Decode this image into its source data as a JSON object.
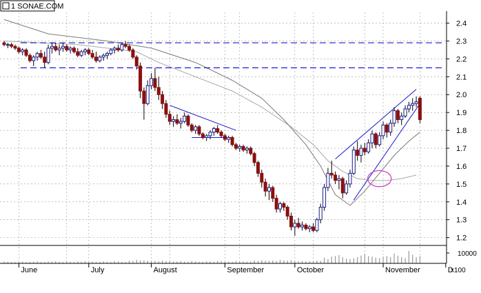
{
  "window": {
    "title": "1 SONAE.COM"
  },
  "colors": {
    "up": "#1a1a8c",
    "down": "#8b1010",
    "channel": "#1a1acc",
    "ellipse": "#cc33cc",
    "grid": "#9a9a9a",
    "ma": "#9a9a9a",
    "volume": "#999999"
  },
  "chart_data": {
    "type": "candlestick",
    "title": "1 SONAE.COM",
    "price_axis": {
      "range": [
        1.16,
        2.46
      ],
      "ticks": [
        "1.2",
        "1.3",
        "1.4",
        "1.5",
        "1.6",
        "1.7",
        "1.8",
        "1.9",
        "2.0",
        "2.1",
        "2.2",
        "2.3",
        "2.4"
      ],
      "side": "right"
    },
    "volume_axis": {
      "range": [
        0,
        16000
      ],
      "ticks": [
        "10000"
      ],
      "unit": "x100"
    },
    "months": [
      "June",
      "July",
      "August",
      "September",
      "October",
      "November",
      "D"
    ],
    "candles": [
      {
        "o": 2.29,
        "h": 2.3,
        "l": 2.27,
        "c": 2.28
      },
      {
        "o": 2.28,
        "h": 2.29,
        "l": 2.26,
        "c": 2.28
      },
      {
        "o": 2.28,
        "h": 2.29,
        "l": 2.26,
        "c": 2.27
      },
      {
        "o": 2.27,
        "h": 2.28,
        "l": 2.25,
        "c": 2.26
      },
      {
        "o": 2.26,
        "h": 2.27,
        "l": 2.23,
        "c": 2.24
      },
      {
        "o": 2.24,
        "h": 2.26,
        "l": 2.22,
        "c": 2.25
      },
      {
        "o": 2.25,
        "h": 2.26,
        "l": 2.21,
        "c": 2.22
      },
      {
        "o": 2.22,
        "h": 2.23,
        "l": 2.18,
        "c": 2.19
      },
      {
        "o": 2.19,
        "h": 2.22,
        "l": 2.16,
        "c": 2.21
      },
      {
        "o": 2.21,
        "h": 2.24,
        "l": 2.19,
        "c": 2.23
      },
      {
        "o": 2.23,
        "h": 2.25,
        "l": 2.2,
        "c": 2.21
      },
      {
        "o": 2.21,
        "h": 2.24,
        "l": 2.15,
        "c": 2.18
      },
      {
        "o": 2.18,
        "h": 2.28,
        "l": 2.17,
        "c": 2.26
      },
      {
        "o": 2.26,
        "h": 2.29,
        "l": 2.23,
        "c": 2.27
      },
      {
        "o": 2.27,
        "h": 2.29,
        "l": 2.24,
        "c": 2.25
      },
      {
        "o": 2.25,
        "h": 2.28,
        "l": 2.22,
        "c": 2.26
      },
      {
        "o": 2.26,
        "h": 2.29,
        "l": 2.24,
        "c": 2.27
      },
      {
        "o": 2.27,
        "h": 2.28,
        "l": 2.24,
        "c": 2.25
      },
      {
        "o": 2.25,
        "h": 2.27,
        "l": 2.23,
        "c": 2.26
      },
      {
        "o": 2.26,
        "h": 2.27,
        "l": 2.23,
        "c": 2.24
      },
      {
        "o": 2.24,
        "h": 2.26,
        "l": 2.21,
        "c": 2.22
      },
      {
        "o": 2.22,
        "h": 2.25,
        "l": 2.21,
        "c": 2.24
      },
      {
        "o": 2.24,
        "h": 2.26,
        "l": 2.22,
        "c": 2.25
      },
      {
        "o": 2.25,
        "h": 2.26,
        "l": 2.22,
        "c": 2.23
      },
      {
        "o": 2.23,
        "h": 2.25,
        "l": 2.2,
        "c": 2.21
      },
      {
        "o": 2.21,
        "h": 2.24,
        "l": 2.18,
        "c": 2.19
      },
      {
        "o": 2.19,
        "h": 2.22,
        "l": 2.18,
        "c": 2.21
      },
      {
        "o": 2.21,
        "h": 2.23,
        "l": 2.19,
        "c": 2.22
      },
      {
        "o": 2.22,
        "h": 2.24,
        "l": 2.2,
        "c": 2.23
      },
      {
        "o": 2.23,
        "h": 2.26,
        "l": 2.22,
        "c": 2.25
      },
      {
        "o": 2.25,
        "h": 2.27,
        "l": 2.23,
        "c": 2.26
      },
      {
        "o": 2.26,
        "h": 2.28,
        "l": 2.24,
        "c": 2.25
      },
      {
        "o": 2.25,
        "h": 2.29,
        "l": 2.24,
        "c": 2.28
      },
      {
        "o": 2.28,
        "h": 2.3,
        "l": 2.26,
        "c": 2.27
      },
      {
        "o": 2.27,
        "h": 2.28,
        "l": 2.24,
        "c": 2.25
      },
      {
        "o": 2.25,
        "h": 2.26,
        "l": 2.2,
        "c": 2.21
      },
      {
        "o": 2.21,
        "h": 2.22,
        "l": 2.14,
        "c": 2.16
      },
      {
        "o": 2.16,
        "h": 2.18,
        "l": 1.98,
        "c": 2.02
      },
      {
        "o": 2.02,
        "h": 2.04,
        "l": 1.86,
        "c": 1.95
      },
      {
        "o": 1.95,
        "h": 2.08,
        "l": 1.94,
        "c": 2.05
      },
      {
        "o": 2.05,
        "h": 2.12,
        "l": 2.03,
        "c": 2.09
      },
      {
        "o": 2.09,
        "h": 2.15,
        "l": 2.02,
        "c": 2.04
      },
      {
        "o": 2.04,
        "h": 2.1,
        "l": 1.97,
        "c": 2.0
      },
      {
        "o": 2.0,
        "h": 2.02,
        "l": 1.92,
        "c": 1.95
      },
      {
        "o": 1.95,
        "h": 1.97,
        "l": 1.87,
        "c": 1.89
      },
      {
        "o": 1.89,
        "h": 1.91,
        "l": 1.83,
        "c": 1.85
      },
      {
        "o": 1.85,
        "h": 1.88,
        "l": 1.82,
        "c": 1.86
      },
      {
        "o": 1.86,
        "h": 1.89,
        "l": 1.83,
        "c": 1.84
      },
      {
        "o": 1.84,
        "h": 1.87,
        "l": 1.81,
        "c": 1.85
      },
      {
        "o": 1.85,
        "h": 1.9,
        "l": 1.84,
        "c": 1.88
      },
      {
        "o": 1.88,
        "h": 1.89,
        "l": 1.82,
        "c": 1.83
      },
      {
        "o": 1.83,
        "h": 1.84,
        "l": 1.79,
        "c": 1.8
      },
      {
        "o": 1.8,
        "h": 1.83,
        "l": 1.78,
        "c": 1.82
      },
      {
        "o": 1.82,
        "h": 1.83,
        "l": 1.77,
        "c": 1.78
      },
      {
        "o": 1.78,
        "h": 1.79,
        "l": 1.75,
        "c": 1.76
      },
      {
        "o": 1.76,
        "h": 1.78,
        "l": 1.74,
        "c": 1.77
      },
      {
        "o": 1.77,
        "h": 1.8,
        "l": 1.75,
        "c": 1.79
      },
      {
        "o": 1.79,
        "h": 1.82,
        "l": 1.77,
        "c": 1.81
      },
      {
        "o": 1.81,
        "h": 1.83,
        "l": 1.78,
        "c": 1.79
      },
      {
        "o": 1.79,
        "h": 1.8,
        "l": 1.76,
        "c": 1.77
      },
      {
        "o": 1.77,
        "h": 1.78,
        "l": 1.74,
        "c": 1.75
      },
      {
        "o": 1.75,
        "h": 1.77,
        "l": 1.73,
        "c": 1.76
      },
      {
        "o": 1.76,
        "h": 1.77,
        "l": 1.71,
        "c": 1.72
      },
      {
        "o": 1.72,
        "h": 1.73,
        "l": 1.69,
        "c": 1.7
      },
      {
        "o": 1.7,
        "h": 1.72,
        "l": 1.68,
        "c": 1.71
      },
      {
        "o": 1.71,
        "h": 1.72,
        "l": 1.68,
        "c": 1.69
      },
      {
        "o": 1.69,
        "h": 1.71,
        "l": 1.67,
        "c": 1.7
      },
      {
        "o": 1.7,
        "h": 1.71,
        "l": 1.66,
        "c": 1.67
      },
      {
        "o": 1.67,
        "h": 1.68,
        "l": 1.6,
        "c": 1.62
      },
      {
        "o": 1.62,
        "h": 1.63,
        "l": 1.54,
        "c": 1.56
      },
      {
        "o": 1.56,
        "h": 1.58,
        "l": 1.48,
        "c": 1.51
      },
      {
        "o": 1.51,
        "h": 1.53,
        "l": 1.43,
        "c": 1.46
      },
      {
        "o": 1.46,
        "h": 1.5,
        "l": 1.41,
        "c": 1.48
      },
      {
        "o": 1.48,
        "h": 1.49,
        "l": 1.4,
        "c": 1.42
      },
      {
        "o": 1.42,
        "h": 1.44,
        "l": 1.34,
        "c": 1.36
      },
      {
        "o": 1.36,
        "h": 1.4,
        "l": 1.34,
        "c": 1.39
      },
      {
        "o": 1.39,
        "h": 1.4,
        "l": 1.35,
        "c": 1.37
      },
      {
        "o": 1.37,
        "h": 1.38,
        "l": 1.3,
        "c": 1.32
      },
      {
        "o": 1.32,
        "h": 1.34,
        "l": 1.24,
        "c": 1.26
      },
      {
        "o": 1.26,
        "h": 1.3,
        "l": 1.21,
        "c": 1.28
      },
      {
        "o": 1.28,
        "h": 1.31,
        "l": 1.25,
        "c": 1.26
      },
      {
        "o": 1.26,
        "h": 1.29,
        "l": 1.24,
        "c": 1.27
      },
      {
        "o": 1.27,
        "h": 1.28,
        "l": 1.24,
        "c": 1.25
      },
      {
        "o": 1.25,
        "h": 1.27,
        "l": 1.23,
        "c": 1.26
      },
      {
        "o": 1.26,
        "h": 1.28,
        "l": 1.23,
        "c": 1.24
      },
      {
        "o": 1.24,
        "h": 1.31,
        "l": 1.23,
        "c": 1.3
      },
      {
        "o": 1.3,
        "h": 1.39,
        "l": 1.28,
        "c": 1.37
      },
      {
        "o": 1.37,
        "h": 1.5,
        "l": 1.35,
        "c": 1.48
      },
      {
        "o": 1.48,
        "h": 1.59,
        "l": 1.46,
        "c": 1.56
      },
      {
        "o": 1.56,
        "h": 1.63,
        "l": 1.53,
        "c": 1.55
      },
      {
        "o": 1.55,
        "h": 1.57,
        "l": 1.5,
        "c": 1.52
      },
      {
        "o": 1.52,
        "h": 1.55,
        "l": 1.47,
        "c": 1.53
      },
      {
        "o": 1.53,
        "h": 1.54,
        "l": 1.42,
        "c": 1.45
      },
      {
        "o": 1.45,
        "h": 1.52,
        "l": 1.44,
        "c": 1.5
      },
      {
        "o": 1.5,
        "h": 1.58,
        "l": 1.48,
        "c": 1.56
      },
      {
        "o": 1.56,
        "h": 1.71,
        "l": 1.55,
        "c": 1.69
      },
      {
        "o": 1.69,
        "h": 1.74,
        "l": 1.63,
        "c": 1.66
      },
      {
        "o": 1.66,
        "h": 1.72,
        "l": 1.62,
        "c": 1.7
      },
      {
        "o": 1.7,
        "h": 1.73,
        "l": 1.66,
        "c": 1.68
      },
      {
        "o": 1.68,
        "h": 1.75,
        "l": 1.67,
        "c": 1.73
      },
      {
        "o": 1.73,
        "h": 1.8,
        "l": 1.7,
        "c": 1.78
      },
      {
        "o": 1.78,
        "h": 1.79,
        "l": 1.7,
        "c": 1.72
      },
      {
        "o": 1.72,
        "h": 1.79,
        "l": 1.71,
        "c": 1.77
      },
      {
        "o": 1.77,
        "h": 1.85,
        "l": 1.75,
        "c": 1.83
      },
      {
        "o": 1.83,
        "h": 1.84,
        "l": 1.76,
        "c": 1.79
      },
      {
        "o": 1.79,
        "h": 1.86,
        "l": 1.77,
        "c": 1.84
      },
      {
        "o": 1.84,
        "h": 1.93,
        "l": 1.82,
        "c": 1.91
      },
      {
        "o": 1.91,
        "h": 1.92,
        "l": 1.84,
        "c": 1.86
      },
      {
        "o": 1.86,
        "h": 1.9,
        "l": 1.83,
        "c": 1.88
      },
      {
        "o": 1.88,
        "h": 1.94,
        "l": 1.87,
        "c": 1.92
      },
      {
        "o": 1.92,
        "h": 1.96,
        "l": 1.9,
        "c": 1.94
      },
      {
        "o": 1.94,
        "h": 1.98,
        "l": 1.91,
        "c": 1.95
      },
      {
        "o": 1.95,
        "h": 1.99,
        "l": 1.93,
        "c": 1.96
      },
      {
        "o": 1.98,
        "h": 1.99,
        "l": 1.84,
        "c": 1.86
      }
    ],
    "moving_averages": [
      {
        "name": "",
        "points": [
          [
            0,
            2.3
          ],
          [
            20,
            2.28
          ],
          [
            36,
            2.24
          ],
          [
            42,
            2.18
          ],
          [
            52,
            2.1
          ],
          [
            62,
            2.02
          ],
          [
            70,
            1.93
          ],
          [
            78,
            1.82
          ],
          [
            84,
            1.72
          ],
          [
            88,
            1.63
          ],
          [
            92,
            1.57
          ],
          [
            96,
            1.53
          ],
          [
            100,
            1.52
          ],
          [
            104,
            1.52
          ],
          [
            108,
            1.53
          ],
          [
            112,
            1.55
          ]
        ]
      },
      {
        "name": "",
        "points": [
          [
            0,
            2.42
          ],
          [
            12,
            2.34
          ],
          [
            28,
            2.3
          ],
          [
            40,
            2.26
          ],
          [
            52,
            2.18
          ],
          [
            62,
            2.08
          ],
          [
            70,
            1.98
          ],
          [
            76,
            1.86
          ],
          [
            82,
            1.72
          ],
          [
            86,
            1.6
          ],
          [
            90,
            1.44
          ],
          [
            94,
            1.38
          ],
          [
            98,
            1.46
          ],
          [
            102,
            1.56
          ],
          [
            106,
            1.66
          ],
          [
            110,
            1.74
          ],
          [
            113,
            1.79
          ]
        ]
      }
    ],
    "resistance_levels": [
      2.29,
      2.15
    ],
    "trendlines": [
      {
        "from": [
          45,
          1.94
        ],
        "to": [
          63,
          1.8
        ]
      },
      {
        "from": [
          51,
          1.76
        ],
        "to": [
          62,
          1.76
        ]
      },
      {
        "from": [
          90,
          1.64
        ],
        "to": [
          112,
          2.03
        ]
      },
      {
        "from": [
          95,
          1.41
        ],
        "to": [
          113,
          1.95
        ]
      }
    ],
    "highlight_ellipse": {
      "center": [
        102,
        1.53
      ],
      "rx_bars": 3.2,
      "ry_price": 0.045
    },
    "volume": [
      1800,
      1500,
      1200,
      1400,
      1300,
      1600,
      1100,
      1500,
      1700,
      1900,
      1300,
      1400,
      1800,
      1600,
      2000,
      1500,
      1300,
      1700,
      1500,
      1200,
      1800,
      1600,
      2100,
      1400,
      1700,
      1300,
      1500,
      1900,
      1600,
      1400,
      2200,
      1800,
      1500,
      1300,
      2600,
      2300,
      3500,
      2800,
      3000,
      2600,
      2200,
      2400,
      2000,
      2600,
      2100,
      1800,
      1700,
      1900,
      2200,
      1600,
      1500,
      2300,
      1900,
      1600,
      1500,
      2000,
      1800,
      1400,
      2400,
      2100,
      1700,
      1600,
      1500,
      2200,
      1800,
      2000,
      1600,
      1700,
      2800,
      2400,
      3000,
      2500,
      2300,
      2700,
      2200,
      3400,
      3000,
      2600,
      3200,
      2500,
      2100,
      2200,
      1800,
      2000,
      2100,
      2600,
      2400,
      5500,
      4200,
      6500,
      7200,
      8000,
      6000,
      4500,
      4200,
      5000,
      6000,
      7500,
      9000,
      7000,
      6500,
      5500,
      5000,
      6500,
      7000,
      6000,
      9500,
      7500,
      6000,
      5000,
      12000,
      8500,
      6000,
      7000
    ]
  }
}
